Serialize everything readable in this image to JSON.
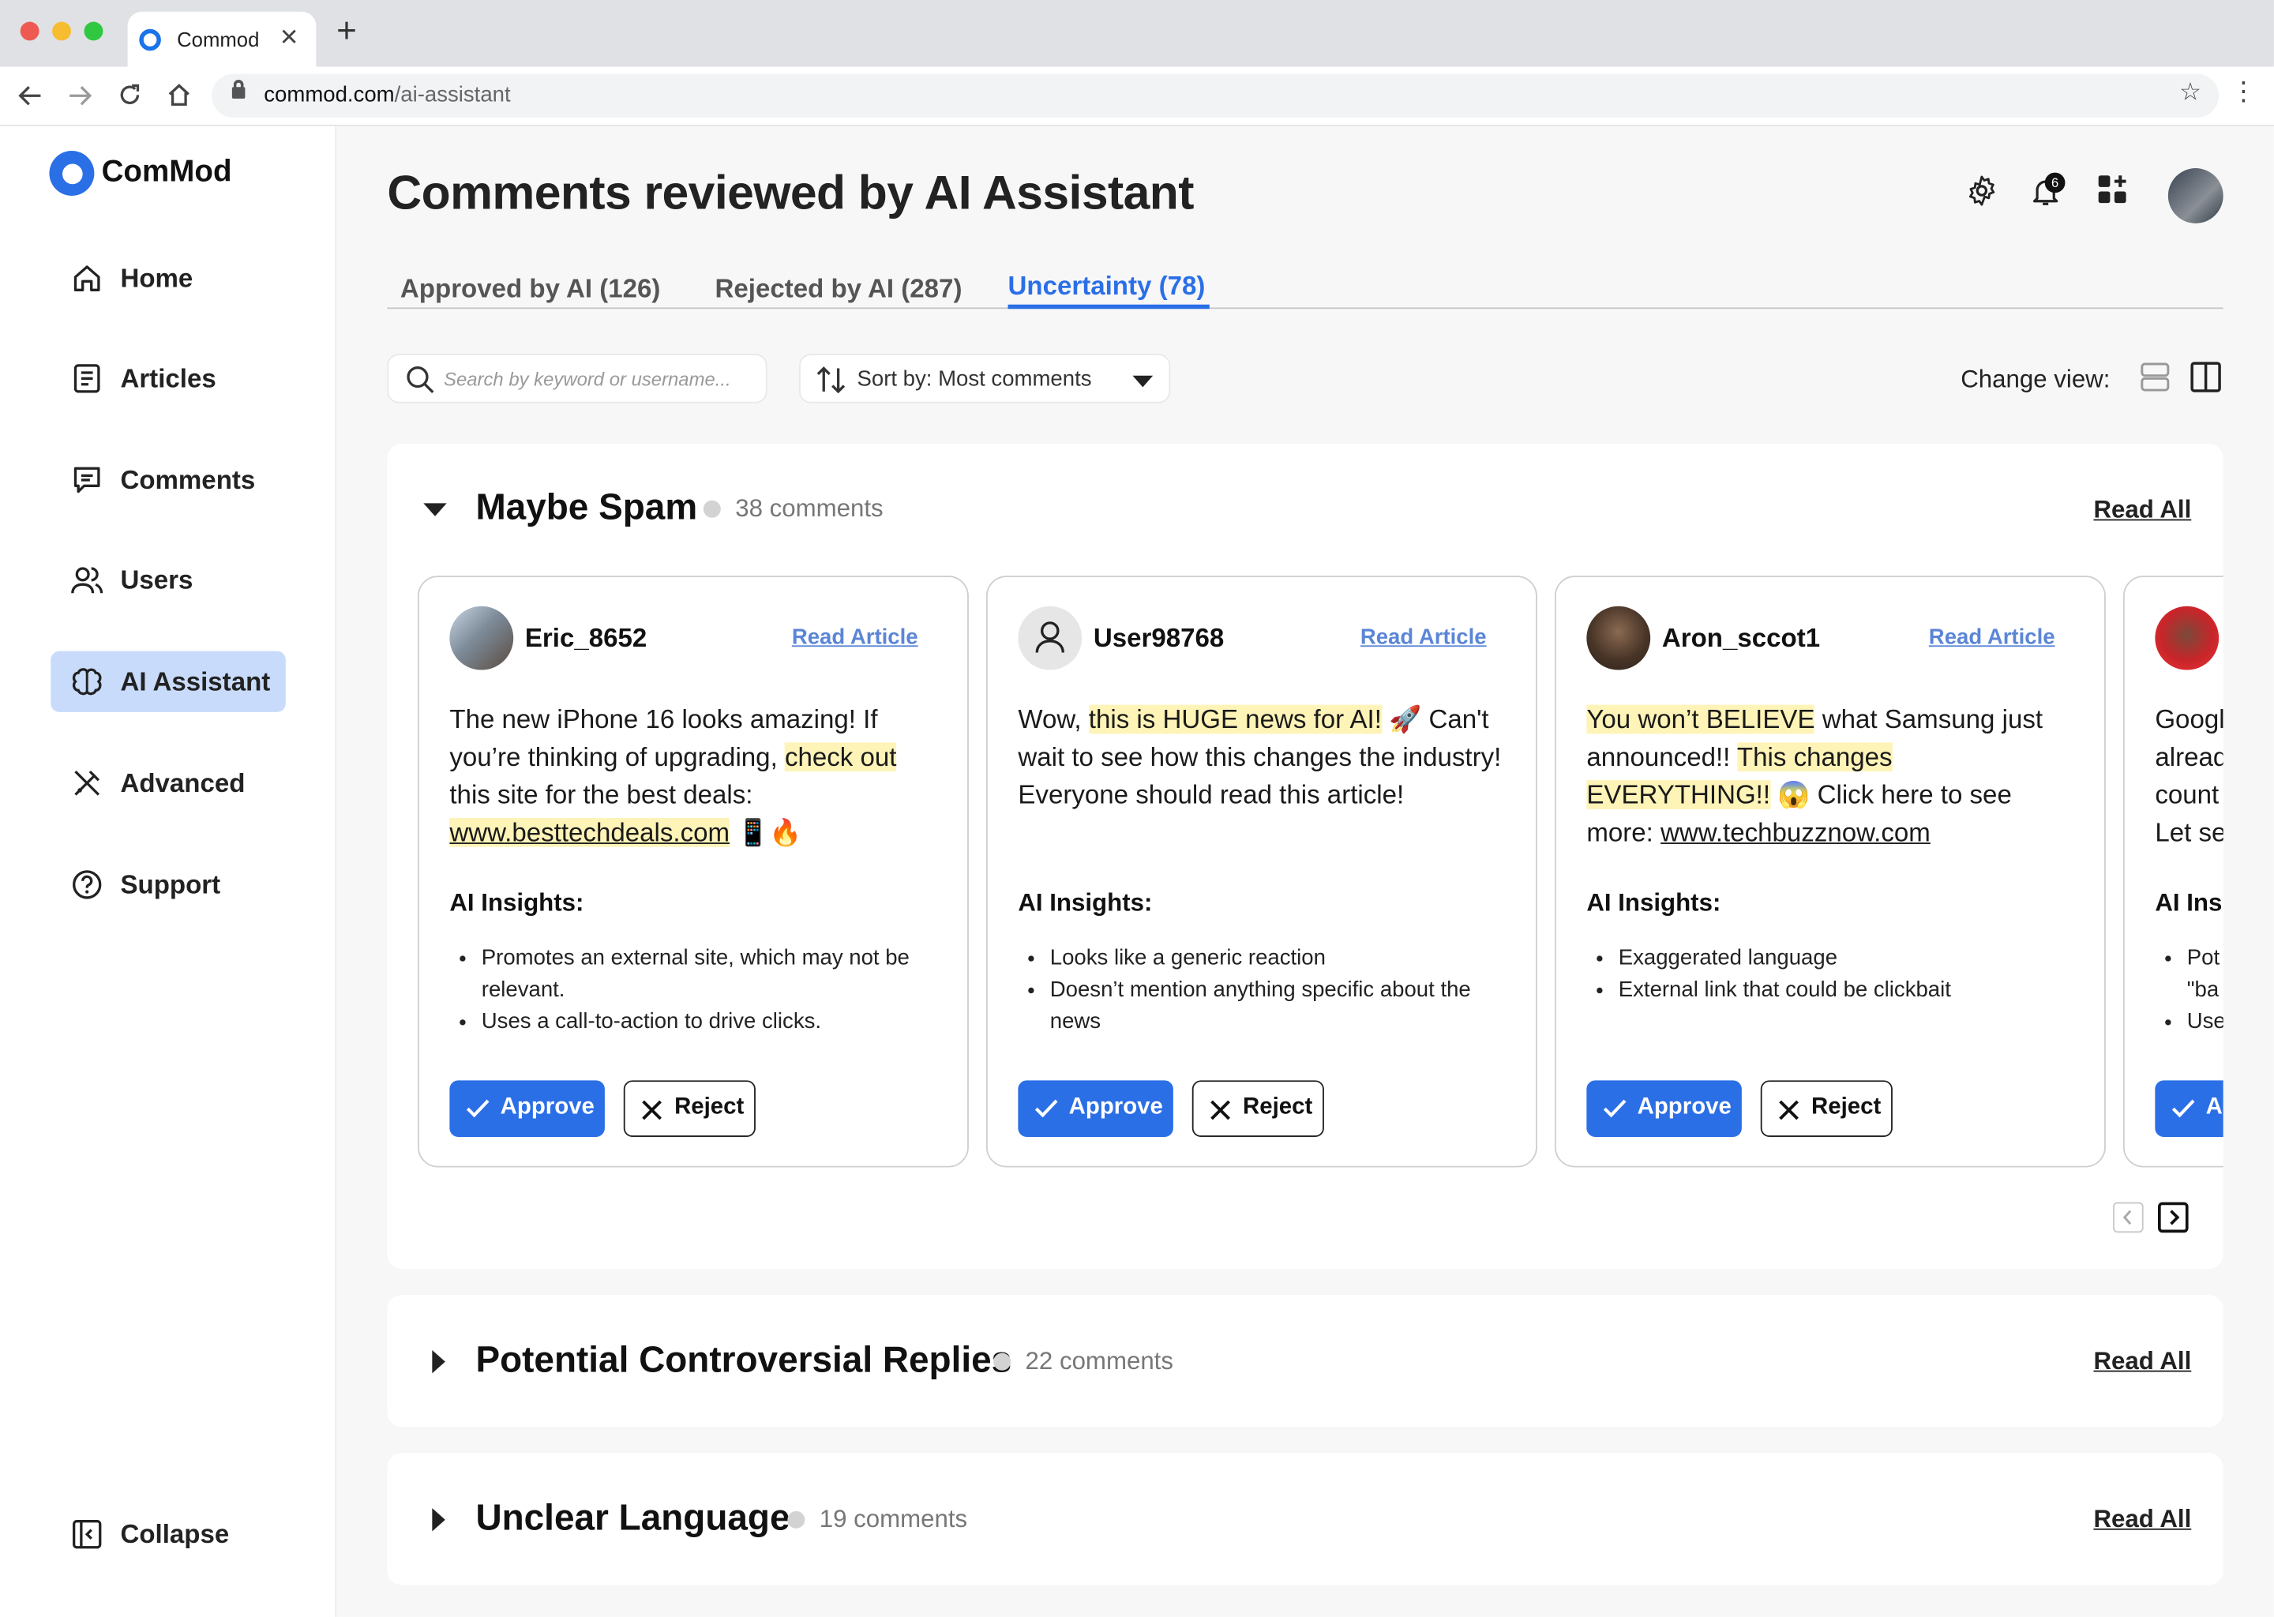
{
  "browser": {
    "tab_title": "Commod",
    "url_host": "commod.com",
    "url_path": "/ai-assistant"
  },
  "sidebar": {
    "brand": "ComMod",
    "items": [
      {
        "label": "Home",
        "icon": "home-icon"
      },
      {
        "label": "Articles",
        "icon": "articles-icon"
      },
      {
        "label": "Comments",
        "icon": "comments-icon"
      },
      {
        "label": "Users",
        "icon": "users-icon"
      },
      {
        "label": "AI Assistant",
        "icon": "brain-icon",
        "active": true
      },
      {
        "label": "Advanced",
        "icon": "advanced-tools-icon"
      },
      {
        "label": "Support",
        "icon": "help-icon"
      }
    ],
    "collapse_label": "Collapse"
  },
  "header": {
    "title": "Comments reviewed by AI Assistant",
    "notification_count": "6"
  },
  "tabs": [
    {
      "label": "Approved by AI (126)"
    },
    {
      "label": "Rejected by AI (287)"
    },
    {
      "label": "Uncertainty (78)",
      "active": true
    }
  ],
  "toolbar": {
    "search_placeholder": "Search by keyword or username...",
    "sort_label": "Sort by: Most comments",
    "change_view_label": "Change view:"
  },
  "groups": [
    {
      "title": "Maybe Spam",
      "count": "38 comments",
      "read_all": "Read All",
      "expanded": true,
      "cards": [
        {
          "username": "Eric_8652",
          "read_article": "Read Article",
          "text_parts": [
            "The new iPhone 16 looks amazing! If you’re thinking of upgrading, ",
            "check out",
            " this site for the best deals: ",
            "www.besttechdeals.com",
            " 📱🔥"
          ],
          "insights_title": "AI Insights:",
          "insights": [
            "Promotes an external site, which may not be relevant.",
            "Uses a call-to-action to drive clicks."
          ],
          "approve": "Approve",
          "reject": "Reject"
        },
        {
          "username": "User98768",
          "read_article": "Read Article",
          "text_parts": [
            "Wow, ",
            "this is HUGE news for AI!",
            " 🚀 Can't wait to see how this changes the industry! Everyone should read this article!"
          ],
          "insights_title": "AI Insights:",
          "insights": [
            "Looks like a generic reaction",
            "Doesn’t mention anything specific about the news"
          ],
          "approve": "Approve",
          "reject": "Reject"
        },
        {
          "username": "Aron_sccot1",
          "read_article": "Read Article",
          "text_parts": [
            "You won’t BELIEVE",
            " what Samsung just announced!! ",
            "This changes EVERYTHING!!",
            " 😱 Click here to see more: ",
            "www.techbuzznow.com"
          ],
          "insights_title": "AI Insights:",
          "insights": [
            "Exaggerated language",
            "External link that could be clickbait"
          ],
          "approve": "Approve",
          "reject": "Reject"
        },
        {
          "username": "",
          "read_article": "",
          "text_parts": [
            "Googl",
            "alread",
            "count",
            "Let se"
          ],
          "insights_title": "AI Ins",
          "insights": [
            "Pot",
            "\"ba",
            "Use"
          ],
          "approve": "A",
          "reject": ""
        }
      ]
    },
    {
      "title": "Potential Controversial Replies",
      "count": "22 comments",
      "read_all": "Read All",
      "expanded": false
    },
    {
      "title": "Unclear Language",
      "count": "19 comments",
      "read_all": "Read All",
      "expanded": false
    }
  ],
  "colors": {
    "accent": "#2b6fe6",
    "active_nav_bg": "#c9dbfb",
    "highlight": "#fff4b8",
    "link": "#5b86d6"
  }
}
